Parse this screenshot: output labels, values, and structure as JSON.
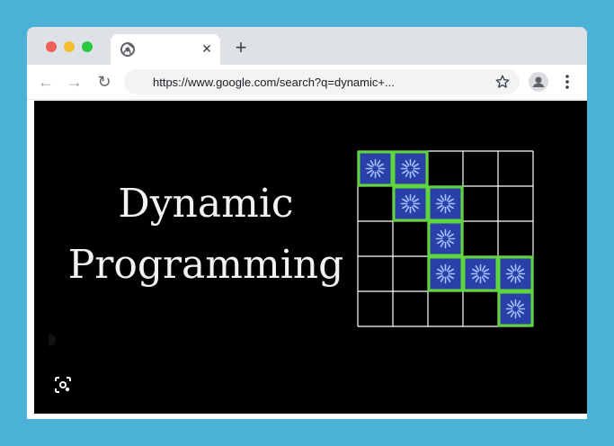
{
  "browser": {
    "tab": {
      "favicon": "chrome-icon",
      "close_icon": "close-icon",
      "title": ""
    },
    "new_tab_icon": "plus-icon",
    "nav": {
      "back_icon": "arrow-left-icon",
      "forward_icon": "arrow-right-icon",
      "reload_icon": "reload-icon"
    },
    "address_bar": {
      "url": "https://www.google.com/search?q=dynamic+..."
    },
    "bookmark_icon": "star-icon",
    "profile_icon": "person-icon",
    "menu_icon": "three-dots-vertical-icon"
  },
  "image": {
    "title_line1": "Dynamic",
    "title_line2": "Programming",
    "lens_icon": "lens-icon",
    "grid": {
      "rows": 5,
      "cols": 5,
      "highlighted": [
        [
          0,
          0
        ],
        [
          0,
          1
        ],
        [
          1,
          1
        ],
        [
          1,
          2
        ],
        [
          2,
          2
        ],
        [
          3,
          2
        ],
        [
          3,
          3
        ],
        [
          3,
          4
        ],
        [
          4,
          4
        ]
      ],
      "highlight_fill": "#2b3fa8",
      "highlight_border": "#5fd63a",
      "line_color": "#ffffff"
    }
  }
}
